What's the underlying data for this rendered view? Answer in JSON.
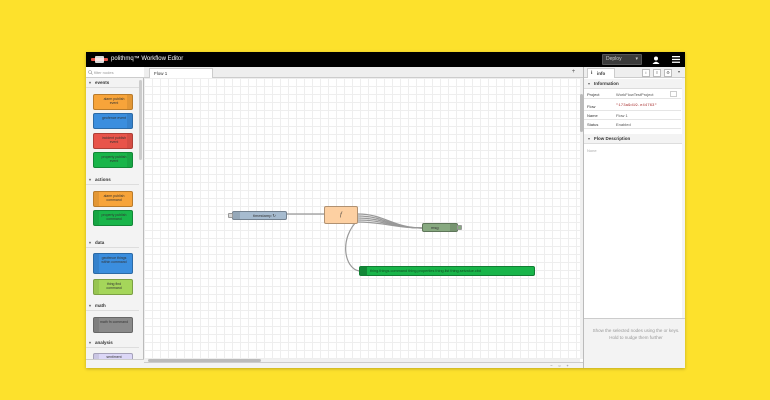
{
  "app": {
    "title": "polithmq™ Workflow Editor",
    "deploy_label": "Deploy"
  },
  "palette": {
    "filter_placeholder": "filter nodes",
    "categories": [
      {
        "label": "events",
        "nodes": [
          "alarm publish event",
          "geofence event",
          "incident publish event",
          "property publish event"
        ]
      },
      {
        "label": "actions",
        "nodes": [
          "alarm publish command",
          "property publish command"
        ]
      },
      {
        "label": "data",
        "nodes": [
          "geofence things within command",
          "thing find command"
        ]
      },
      {
        "label": "math",
        "nodes": [
          "math fn command"
        ]
      },
      {
        "label": "analysis",
        "nodes": [
          "sentiment"
        ]
      }
    ]
  },
  "workspace": {
    "tab_label": "Flow 1",
    "nodes": {
      "timestamp": "timestamp ↻",
      "function": "f",
      "msg": "msg",
      "command": "thing.things.command thing.properties thing.list thing.setvalue.cbd"
    }
  },
  "sidebar": {
    "tab_label": "info",
    "info_header": "Information",
    "rows": [
      {
        "key": "Project",
        "value": "WorkFlowTestProject"
      },
      {
        "key": "Flow",
        "value": "\"173a9d19.e44763\""
      },
      {
        "key": "Name",
        "value": "Flow 1"
      },
      {
        "key": "Status",
        "value": "Enabled"
      }
    ],
    "desc_header": "Flow Description",
    "desc_text": "None",
    "help_text": "Show the selected nodes using the or keys. Hold to nudge them further"
  },
  "colors": {
    "accent": "#fde12c",
    "topbar": "#000000"
  }
}
